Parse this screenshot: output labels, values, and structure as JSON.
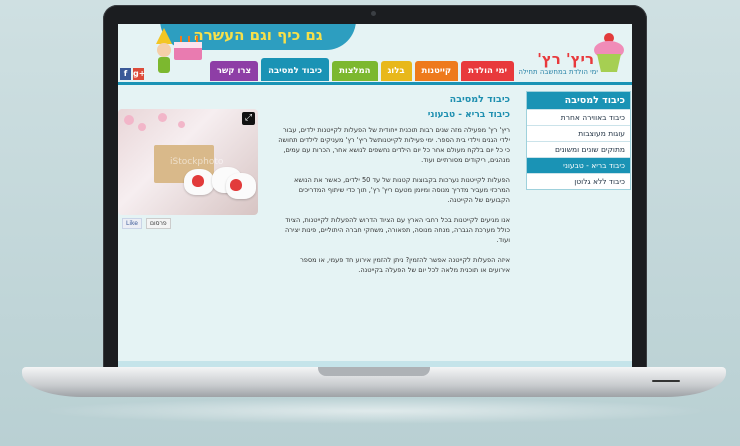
{
  "header": {
    "banner_text": "גם כיף וגם העשרה",
    "logo_name": "ריץ' רץ'",
    "logo_tagline": "ימי הולדת במחשבה תחילה"
  },
  "nav": [
    {
      "label": "ימי הולדת",
      "color": "#e8393c"
    },
    {
      "label": "קייטנות",
      "color": "#ee7a1c"
    },
    {
      "label": "בלוג",
      "color": "#e8b81b"
    },
    {
      "label": "המלצות",
      "color": "#7cb82f"
    },
    {
      "label": "כיבוד למסיבה",
      "color": "#1a93b5"
    },
    {
      "label": "צרו קשר",
      "color": "#8e3ea6"
    }
  ],
  "social": [
    {
      "icon": "google-plus-icon",
      "label": "g+",
      "color": "#dd4b39"
    },
    {
      "icon": "facebook-icon",
      "label": "f",
      "color": "#3b5998"
    }
  ],
  "sidebar": {
    "title": "כיבוד למסיבה",
    "items": [
      {
        "label": "כיבוד באווירה אחרת",
        "active": false
      },
      {
        "label": "עוגות מעוצבות",
        "active": false
      },
      {
        "label": "מתוקים שונים ומשונים",
        "active": false
      },
      {
        "label": "כיבוד בריא - טבעוני",
        "active": true
      },
      {
        "label": "כיבוד ללא גלוטן",
        "active": false
      }
    ]
  },
  "main": {
    "title": "כיבוד למסיבה",
    "subtitle": "כיבוד בריא - טבעוני",
    "paragraphs": [
      "ריץ' רץ' מפעילה מזה שנים רבות תוכנית ייחודית של הפעלות לקייטנות ילדים, עבור ילדי הגנים וילדי בית הספר. ימי פעילות לקייטנותשל ריץ' רץ' מעניקים לילדים תחושה כי כל יום בלקח מעולם אחר כל יום הילדים נחשפים לנושא אחר, הכרות עם עמים, מנהגים, ריקודים מסורתיים ועוד.",
      "הפעלות לקייטנות נערכות בקבוצות קטנות של עד 50 ילדים, כאשר את הנושא המרכזי מעביר מדריך מנוסה ומיומן מטעם ריץ' רץ', תוך כדי שיתוף המדריכים הקבועים של הקייטנה.",
      "אנו מגיעים לקייטנות בכל רחבי הארץ עם הציוד הדרוש להפעלות לקייטנות, הציוד כולל מערכת הגברה, מנחה מנוסה, תפאורה, משחקי חברה היתוליים, פינות יצירה ועוד.",
      "איזה הפעלות לקייטנה אפשר להזמין? ניתן להזמין אירוע חד פעמי, או מספר אירועים או תוכנית מלאה לכל יום של הפעלה בקייטנה."
    ]
  },
  "photo": {
    "watermark": "iStockphoto",
    "fullscreen_icon": "expand-icon"
  },
  "share": {
    "like_label": "Like",
    "print_label": "פרסום"
  }
}
